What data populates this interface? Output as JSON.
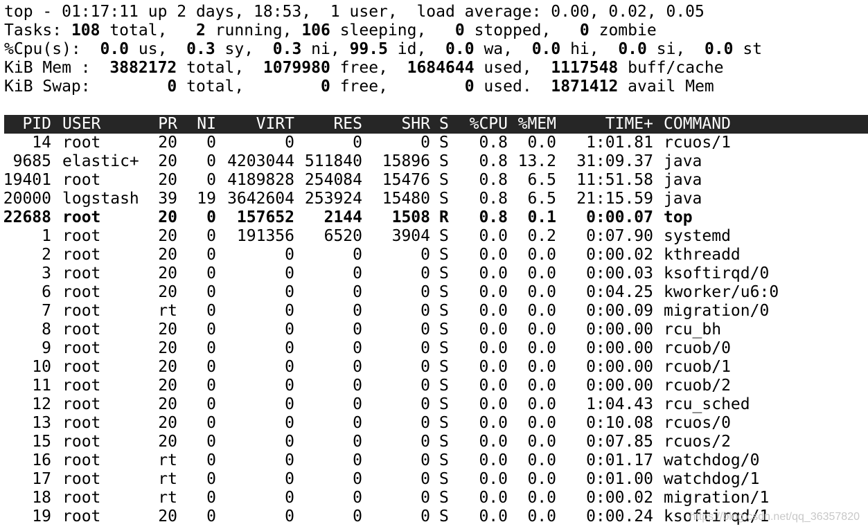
{
  "summary": {
    "uptime_line": {
      "prefix": "top - ",
      "time": "01:17:11",
      "rest": " up 2 days, 18:53,  1 user,  load average: 0.00, 0.02, 0.05"
    },
    "tasks": {
      "label": "Tasks: ",
      "total": "108",
      "total_label": " total,   ",
      "running": "2",
      "running_label": " running, ",
      "sleeping": "106",
      "sleeping_label": " sleeping,   ",
      "stopped": "0",
      "stopped_label": " stopped,   ",
      "zombie": "0",
      "zombie_label": " zombie"
    },
    "cpu": {
      "label": "%Cpu(s):  ",
      "us": "0.0",
      "us_label": " us,  ",
      "sy": "0.3",
      "sy_label": " sy,  ",
      "ni": "0.3",
      "ni_label": " ni, ",
      "id": "99.5",
      "id_label": " id,  ",
      "wa": "0.0",
      "wa_label": " wa,  ",
      "hi": "0.0",
      "hi_label": " hi,  ",
      "si": "0.0",
      "si_label": " si,  ",
      "st": "0.0",
      "st_label": " st"
    },
    "mem": {
      "label": "KiB Mem :  ",
      "total": "3882172",
      "total_label": " total,  ",
      "free": "1079980",
      "free_label": " free,  ",
      "used": "1684644",
      "used_label": " used,  ",
      "buff": "1117548",
      "buff_label": " buff/cache"
    },
    "swap": {
      "label": "KiB Swap:        ",
      "total": "0",
      "total_label": " total,        ",
      "free": "0",
      "free_label": " free,        ",
      "used": "0",
      "used_label": " used.  ",
      "avail": "1871412",
      "avail_label": " avail Mem"
    }
  },
  "table": {
    "columns": [
      "PID",
      "USER",
      "PR",
      "NI",
      "VIRT",
      "RES",
      "SHR",
      "S",
      "%CPU",
      "%MEM",
      "TIME+",
      "COMMAND"
    ],
    "rows": [
      [
        "14",
        "root",
        "20",
        "0",
        "0",
        "0",
        "0",
        "S",
        "0.8",
        "0.0",
        "1:01.81",
        "rcuos/1"
      ],
      [
        "9685",
        "elastic+",
        "20",
        "0",
        "4203044",
        "511840",
        "15896",
        "S",
        "0.8",
        "13.2",
        "31:09.37",
        "java"
      ],
      [
        "19401",
        "root",
        "20",
        "0",
        "4189828",
        "254084",
        "15476",
        "S",
        "0.8",
        "6.5",
        "11:51.58",
        "java"
      ],
      [
        "20000",
        "logstash",
        "39",
        "19",
        "3642604",
        "253924",
        "15480",
        "S",
        "0.8",
        "6.5",
        "21:15.59",
        "java"
      ],
      [
        "22688",
        "root",
        "20",
        "0",
        "157652",
        "2144",
        "1508",
        "R",
        "0.8",
        "0.1",
        "0:00.07",
        "top"
      ],
      [
        "1",
        "root",
        "20",
        "0",
        "191356",
        "6520",
        "3904",
        "S",
        "0.0",
        "0.2",
        "0:07.90",
        "systemd"
      ],
      [
        "2",
        "root",
        "20",
        "0",
        "0",
        "0",
        "0",
        "S",
        "0.0",
        "0.0",
        "0:00.02",
        "kthreadd"
      ],
      [
        "3",
        "root",
        "20",
        "0",
        "0",
        "0",
        "0",
        "S",
        "0.0",
        "0.0",
        "0:00.03",
        "ksoftirqd/0"
      ],
      [
        "6",
        "root",
        "20",
        "0",
        "0",
        "0",
        "0",
        "S",
        "0.0",
        "0.0",
        "0:04.25",
        "kworker/u6:0"
      ],
      [
        "7",
        "root",
        "rt",
        "0",
        "0",
        "0",
        "0",
        "S",
        "0.0",
        "0.0",
        "0:00.09",
        "migration/0"
      ],
      [
        "8",
        "root",
        "20",
        "0",
        "0",
        "0",
        "0",
        "S",
        "0.0",
        "0.0",
        "0:00.00",
        "rcu_bh"
      ],
      [
        "9",
        "root",
        "20",
        "0",
        "0",
        "0",
        "0",
        "S",
        "0.0",
        "0.0",
        "0:00.00",
        "rcuob/0"
      ],
      [
        "10",
        "root",
        "20",
        "0",
        "0",
        "0",
        "0",
        "S",
        "0.0",
        "0.0",
        "0:00.00",
        "rcuob/1"
      ],
      [
        "11",
        "root",
        "20",
        "0",
        "0",
        "0",
        "0",
        "S",
        "0.0",
        "0.0",
        "0:00.00",
        "rcuob/2"
      ],
      [
        "12",
        "root",
        "20",
        "0",
        "0",
        "0",
        "0",
        "S",
        "0.0",
        "0.0",
        "1:04.43",
        "rcu_sched"
      ],
      [
        "13",
        "root",
        "20",
        "0",
        "0",
        "0",
        "0",
        "S",
        "0.0",
        "0.0",
        "0:10.08",
        "rcuos/0"
      ],
      [
        "15",
        "root",
        "20",
        "0",
        "0",
        "0",
        "0",
        "S",
        "0.0",
        "0.0",
        "0:07.85",
        "rcuos/2"
      ],
      [
        "16",
        "root",
        "rt",
        "0",
        "0",
        "0",
        "0",
        "S",
        "0.0",
        "0.0",
        "0:01.17",
        "watchdog/0"
      ],
      [
        "17",
        "root",
        "rt",
        "0",
        "0",
        "0",
        "0",
        "S",
        "0.0",
        "0.0",
        "0:01.00",
        "watchdog/1"
      ],
      [
        "18",
        "root",
        "rt",
        "0",
        "0",
        "0",
        "0",
        "S",
        "0.0",
        "0.0",
        "0:00.02",
        "migration/1"
      ],
      [
        "19",
        "root",
        "20",
        "0",
        "0",
        "0",
        "0",
        "S",
        "0.0",
        "0.0",
        "0:00.24",
        "ksoftirqd/1"
      ]
    ],
    "highlighted_pid": "22688"
  },
  "watermark": "https://blog.csdn.net/qq_36357820",
  "colors": {
    "background": "#ffffff",
    "text": "#000000",
    "header_bar": "#262626",
    "header_text": "#ffffff"
  }
}
